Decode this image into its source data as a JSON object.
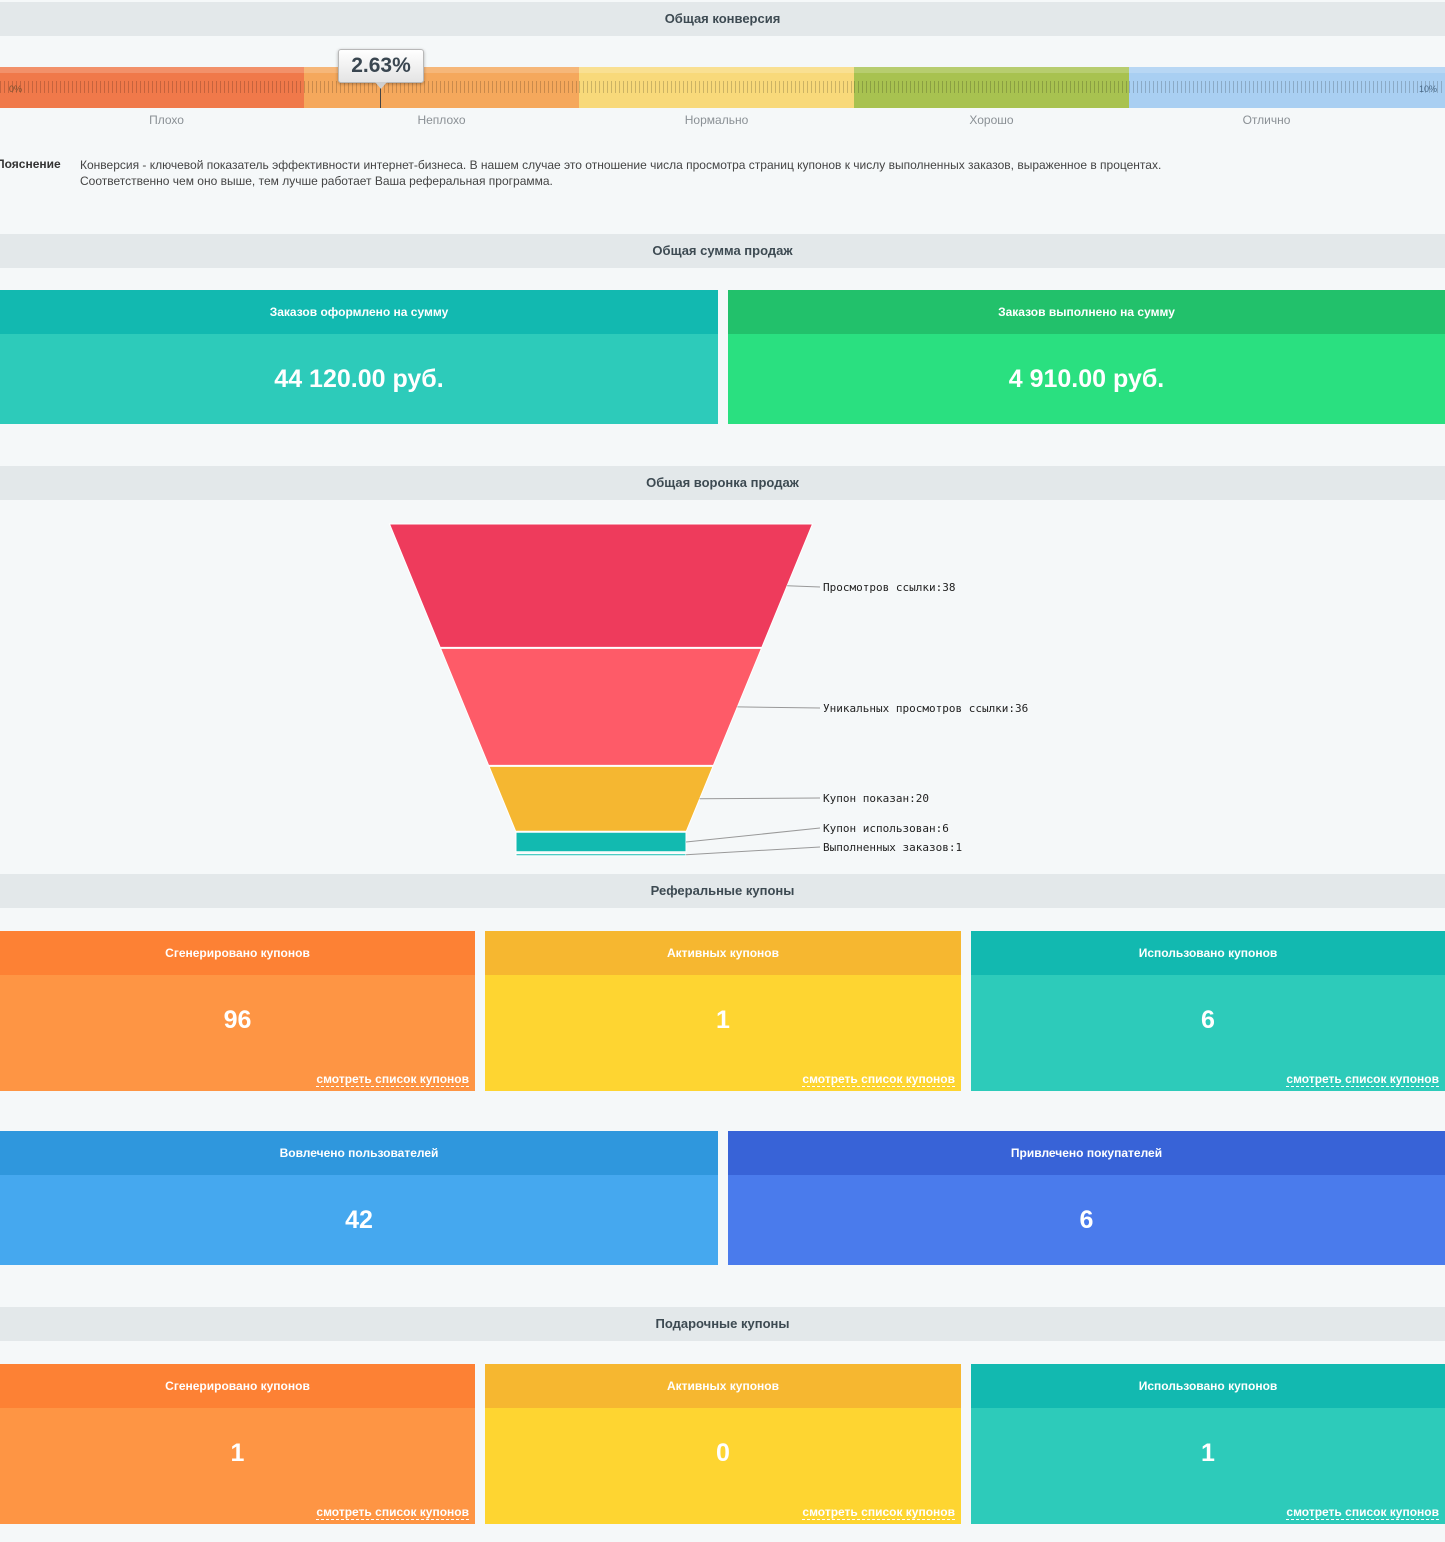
{
  "sections": {
    "conversion": "Общая конверсия",
    "sales_sum": "Общая сумма продаж",
    "funnel": "Общая воронка продаж",
    "referral": "Реферальные купоны",
    "gift": "Подарочные купоны"
  },
  "conversion": {
    "value": 2.63,
    "value_label": "2.63%",
    "min_label": "0%",
    "max_label": "10%",
    "range": [
      0,
      10
    ],
    "zones": [
      {
        "label": "Плохо",
        "color": "#f0794a"
      },
      {
        "label": "Неплохо",
        "color": "#f5a85c"
      },
      {
        "label": "Нормально",
        "color": "#f8d97a"
      },
      {
        "label": "Хорошо",
        "color": "#a8c250"
      },
      {
        "label": "Отлично",
        "color": "#a9cff2"
      }
    ],
    "explanation_title": "Пояснение",
    "explanation_line1": "Конверсия - ключевой показатель эффективности интернет-бизнеса. В нашем случае это отношение числа просмотра страниц купонов к числу выполненных заказов, выраженное в процентах.",
    "explanation_line2": "Соответственно чем оно выше, тем лучше работает Ваша реферальная программа."
  },
  "sales": {
    "placed_title": "Заказов оформлено на сумму",
    "placed_value": "44 120.00 руб.",
    "completed_title": "Заказов выполнено на сумму",
    "completed_value": "4 910.00 руб."
  },
  "chart_data": {
    "type": "funnel",
    "categories": [
      "Просмотров ссылки",
      "Уникальных просмотров ссылки",
      "Купон показан",
      "Купон использован",
      "Выполненных заказов"
    ],
    "values": [
      38,
      36,
      20,
      6,
      1
    ],
    "labels": [
      "Просмотров ссылки:38",
      "Уникальных просмотров ссылки:36",
      "Купон показан:20",
      "Купон использован:6",
      "Выполненных заказов:1"
    ],
    "colors": [
      "#ee3b5c",
      "#fe5b68",
      "#f5b731",
      "#12bab0",
      "#12bab0"
    ]
  },
  "referral": {
    "generated_title": "Сгенерировано купонов",
    "generated_value": "96",
    "active_title": "Активных купонов",
    "active_value": "1",
    "used_title": "Использовано купонов",
    "used_value": "6",
    "link": "смотреть список купонов",
    "involved_title": "Вовлечено пользователей",
    "involved_value": "42",
    "buyers_title": "Привлечено покупателей",
    "buyers_value": "6"
  },
  "gift": {
    "generated_title": "Сгенерировано купонов",
    "generated_value": "1",
    "active_title": "Активных купонов",
    "active_value": "0",
    "used_title": "Использовано купонов",
    "used_value": "1",
    "link": "смотреть список купонов"
  }
}
